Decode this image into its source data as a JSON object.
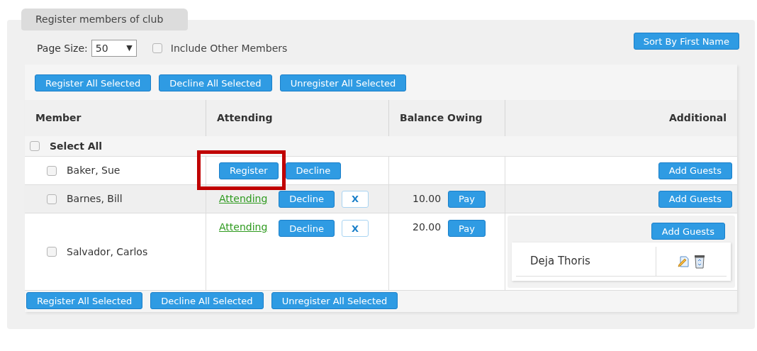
{
  "tab": {
    "label": "Register members of club"
  },
  "page_size": {
    "label": "Page Size:",
    "value": "50",
    "caret": "▼"
  },
  "include_other": {
    "label": "Include Other Members",
    "checked": false
  },
  "sort_button": "Sort By First Name",
  "top_actions": [
    "Register All Selected",
    "Decline All Selected",
    "Unregister All Selected"
  ],
  "columns": [
    "Member",
    "Attending",
    "Balance Owing",
    "Additional"
  ],
  "select_all": {
    "label": "Select All",
    "checked": false
  },
  "rows": [
    {
      "name": "Baker, Sue",
      "checked": false,
      "attending": [
        {
          "kind": "button",
          "label": "Register",
          "highlighted": true
        },
        {
          "kind": "button",
          "label": "Decline",
          "highlighted": false
        }
      ],
      "add_guests": "Add Guests"
    },
    {
      "name": "Barnes, Bill",
      "checked": false,
      "attending": [
        {
          "kind": "link",
          "label": "Attending",
          "highlighted": false
        },
        {
          "kind": "button",
          "label": "Decline",
          "highlighted": false
        },
        {
          "kind": "remove",
          "label": "X",
          "highlighted": false
        }
      ],
      "balance": {
        "amount": "10.00",
        "pay": "Pay"
      },
      "add_guests": "Add Guests"
    },
    {
      "name": "Salvador, Carlos",
      "checked": false,
      "attending": [
        {
          "kind": "link",
          "label": "Attending",
          "highlighted": false
        },
        {
          "kind": "button",
          "label": "Decline",
          "highlighted": false
        },
        {
          "kind": "remove",
          "label": "X",
          "highlighted": false
        }
      ],
      "balance": {
        "amount": "20.00",
        "pay": "Pay"
      },
      "add_guests": "Add Guests",
      "guests": [
        {
          "name": "Deja Thoris"
        }
      ]
    }
  ],
  "bottom_actions": [
    "Register All Selected",
    "Decline All Selected",
    "Unregister All Selected"
  ]
}
